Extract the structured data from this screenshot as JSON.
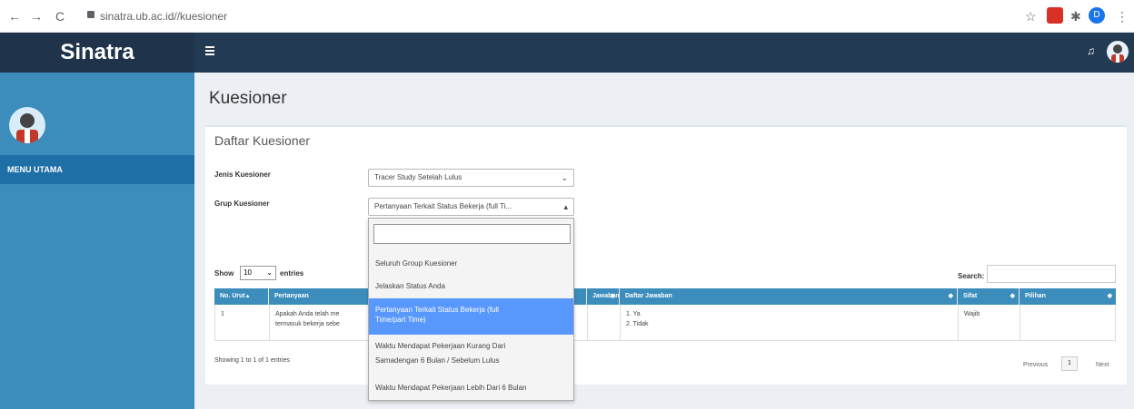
{
  "browser": {
    "back": "←",
    "forward": "→",
    "reload": "C",
    "url": "sinatra.ub.ac.id//kuesioner",
    "star": "☆",
    "puzzle": "✱",
    "more": "⋮",
    "profile_initial": "D"
  },
  "app": {
    "brand": "Sinatra",
    "bell": "♫"
  },
  "sidebar": {
    "menu_label": "MENU UTAMA"
  },
  "page": {
    "title": "Kuesioner",
    "panel_title": "Daftar Kuesioner"
  },
  "form": {
    "jenis_label": "Jenis Kuesioner",
    "jenis_value": "Tracer Study Setelah Lulus",
    "grup_label": "Grup Kuesioner",
    "grup_value": "Pertanyaan Terkait Status Bekerja (full Ti...",
    "dropdown_options": [
      "Seluruh Group Kuesioner",
      "Jelaskan Status Anda",
      "Pertanyaan Terkait Status Bekerja (full",
      "Time/part Time)",
      "Waktu Mendapat Pekerjaan Kurang Dari",
      "Samadengan 6 Bulan / Sebelum Lulus",
      "Waktu Mendapat Pekerjaan Lebih Dari 6 Bulan"
    ]
  },
  "table": {
    "show_label": "Show",
    "entries_value": "10",
    "entries_label": "entries",
    "search_label": "Search:",
    "headers": [
      "No. Urut",
      "Pertanyaan",
      "Jawaban",
      "Daftar Jawaban",
      "Sifat",
      "Pilihan"
    ],
    "rows": [
      {
        "no": "1",
        "question_line1": "Apakah Anda telah me",
        "question_line2": "termasuk bekerja sebe",
        "answer_line1": "1. Ya",
        "answer_line2": "2. Tidak",
        "sifat": "Wajib",
        "pilihan": ""
      }
    ],
    "info": "Showing 1 to 1 of 1 entries",
    "previous": "Previous",
    "page": "1",
    "next": "Next"
  },
  "colors": {
    "sidebar": "#3c8dbc",
    "topbar": "#233b52",
    "accent": "#5897fb"
  }
}
